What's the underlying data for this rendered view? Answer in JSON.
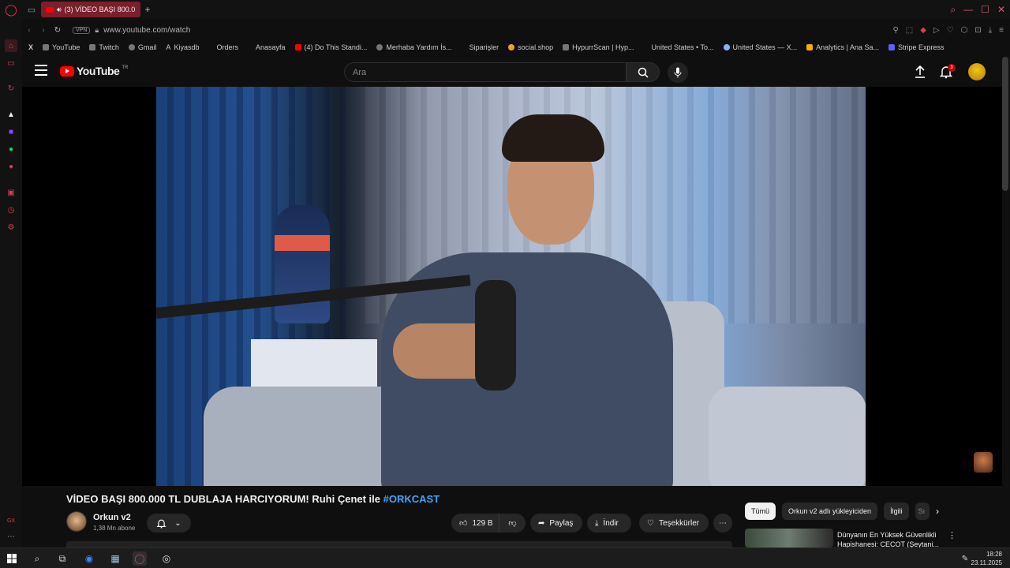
{
  "browser": {
    "active_tab_title": "(3) VİDEO BAŞI 800.0",
    "url": "www.youtube.com/watch",
    "vpn_label": "VPN",
    "bookmarks": [
      {
        "label": "YouTube",
        "icon": "youtube-icon"
      },
      {
        "label": "Twitch",
        "icon": "twitch-icon"
      },
      {
        "label": "Gmail",
        "icon": "gmail-icon"
      },
      {
        "label": "Kiyasdb",
        "icon": "kiyasdb-icon"
      },
      {
        "label": "Orders",
        "icon": "orders-icon"
      },
      {
        "label": "Anasayfa",
        "icon": "home-icon"
      },
      {
        "label": "(4) Do This Standi...",
        "icon": "youtube-icon"
      },
      {
        "label": "Merhaba Yardım İs...",
        "icon": "openai-icon"
      },
      {
        "label": "Siparişler",
        "icon": "orders-icon"
      },
      {
        "label": "social.shop",
        "icon": "shop-icon"
      },
      {
        "label": "HypurrScan | Hyp...",
        "icon": "hypurr-icon"
      },
      {
        "label": "United States • To...",
        "icon": "flag-icon"
      },
      {
        "label": "United States — X...",
        "icon": "globe-icon"
      },
      {
        "label": "Analytics | Ana Sa...",
        "icon": "analytics-icon"
      },
      {
        "label": "Stripe Express",
        "icon": "stripe-icon"
      }
    ]
  },
  "youtube": {
    "logo_text": "YouTube",
    "logo_region": "TR",
    "search_placeholder": "Ara",
    "notification_count": "3"
  },
  "video": {
    "title_main": "VİDEO BAŞI 800.000 TL DUBLAJA HARCIYORUM! Ruhi Çenet ile ",
    "title_tag": "#ORKCAST",
    "channel_name": "Orkun v2",
    "subscribers": "1,38 Mn abone",
    "like_count": "129 B",
    "share_label": "Paylaş",
    "download_label": "İndir",
    "thanks_label": "Teşekkürler"
  },
  "recommendations": {
    "chips": [
      "Tümü",
      "Orkun v2 adlı yükleyiciden",
      "İlgili",
      "Sı"
    ],
    "items": [
      {
        "title": "Dünyanın En Yüksek Güvenlikli Hapishanesi: CECOT (Şeytani..."
      }
    ]
  },
  "taskbar": {
    "time": "18:28",
    "date": "23.11.2025"
  }
}
